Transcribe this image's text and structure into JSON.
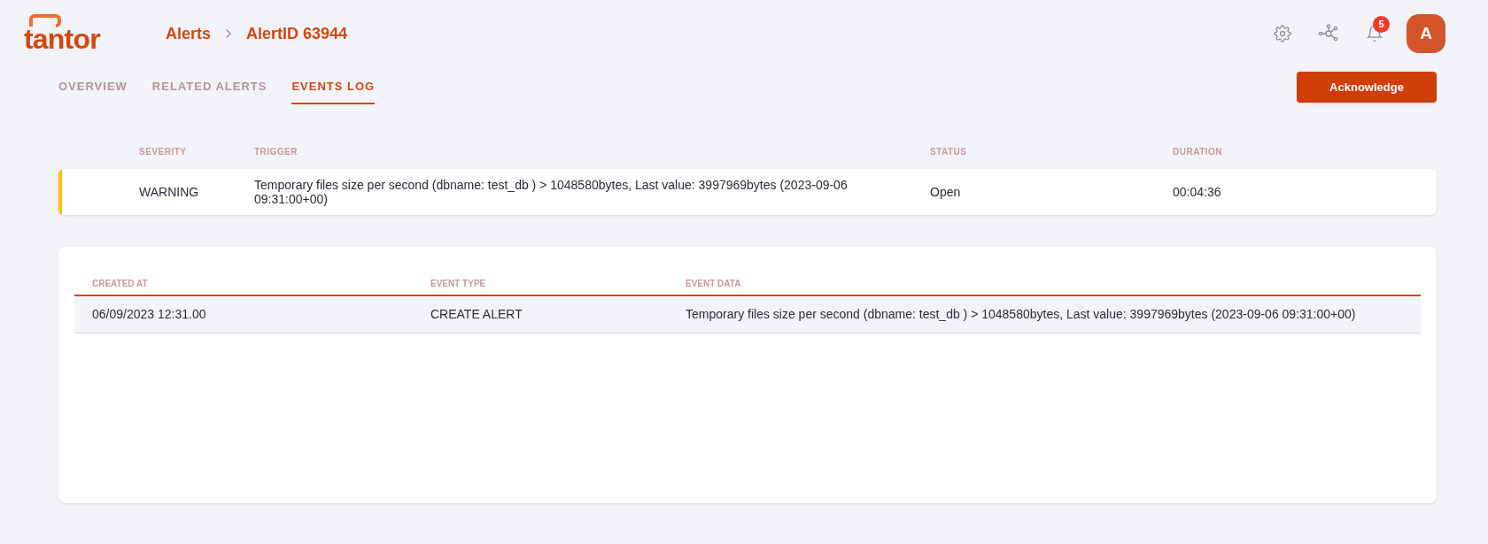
{
  "logo": {
    "text": "tantor"
  },
  "breadcrumb": [
    "Alerts",
    "AlertID 63944"
  ],
  "header": {
    "badge": "5",
    "avatar": "A"
  },
  "tabs": [
    {
      "label": "OVERVIEW",
      "selected": false
    },
    {
      "label": "RELATED ALERTS",
      "selected": false
    },
    {
      "label": "EVENTS LOG",
      "selected": true
    }
  ],
  "acknowledge_button": "Acknowledge",
  "alert_table": {
    "columns": [
      "SEVERITY",
      "TRIGGER",
      "STATUS",
      "DURATION"
    ],
    "rows": [
      {
        "color": "#ffc107",
        "cells": [
          "WARNING",
          "Temporary files size per second (dbname: test_db ) > 1048580bytes, Last value: 3997969bytes (2023-09-06 09:31:00+00)",
          "Open",
          "00:04:36"
        ]
      }
    ]
  },
  "events_table": {
    "columns": [
      "CREATED AT",
      "EVENT TYPE",
      "EVENT DATA"
    ],
    "rows": [
      [
        "06/09/2023 12:31.00",
        "CREATE ALERT",
        "Temporary files size per second (dbname: test_db ) > 1048580bytes, Last value: 3997969bytes (2023-09-06 09:31:00+00)"
      ]
    ]
  }
}
